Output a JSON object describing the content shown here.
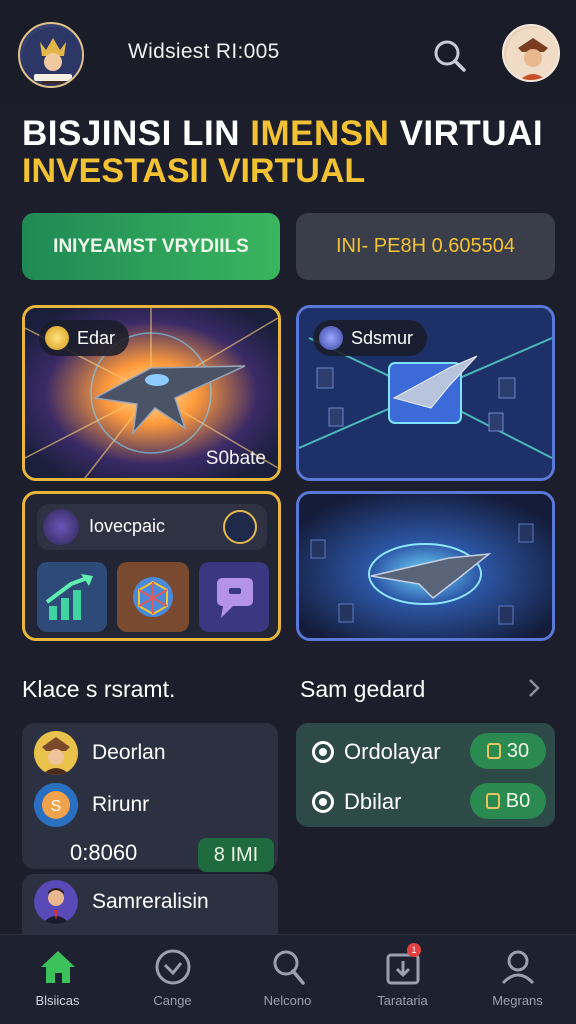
{
  "header": {
    "title": "Widsiest RI:005"
  },
  "hero": {
    "line1_a": "BISJINSI LIN ",
    "line1_b": "IMENSN",
    "line1_c": " VIRTUAI",
    "line2": "INVESTASII VIRTUAL"
  },
  "actions": {
    "primary_label": "INIYEAMST VRYDIILS",
    "balance_label": "INI- PE8H 0.605504"
  },
  "cards": [
    {
      "label": "Edar",
      "tag": "S0bate"
    },
    {
      "label": "Sdsmur"
    },
    {
      "label": "Iovecpaic"
    },
    {}
  ],
  "sections": {
    "left_title": "Klace s rsramt.",
    "right_title": "Sam gedard"
  },
  "list": {
    "rows": [
      {
        "name": "Deorlan"
      },
      {
        "name": "Rirunr"
      }
    ],
    "amount": "0:8060",
    "amount_chip": "8 IMI",
    "second_row": "Samreralisin"
  },
  "right_list": [
    {
      "name": "Ordolayar",
      "value": "30"
    },
    {
      "name": "Dbilar",
      "value": "B0"
    }
  ],
  "nav": [
    {
      "label": "Blsiicas",
      "icon": "home-icon"
    },
    {
      "label": "Cange",
      "icon": "check-circle-icon"
    },
    {
      "label": "Nelcono",
      "icon": "search-icon"
    },
    {
      "label": "Tarataria",
      "icon": "inbox-icon",
      "badge": "1"
    },
    {
      "label": "Megrans",
      "icon": "profile-icon"
    }
  ],
  "colors": {
    "background": "#1c1f2b",
    "accent_gold": "#f2c233",
    "accent_green": "#3bb55f",
    "nav_active": "#3bc25a"
  }
}
